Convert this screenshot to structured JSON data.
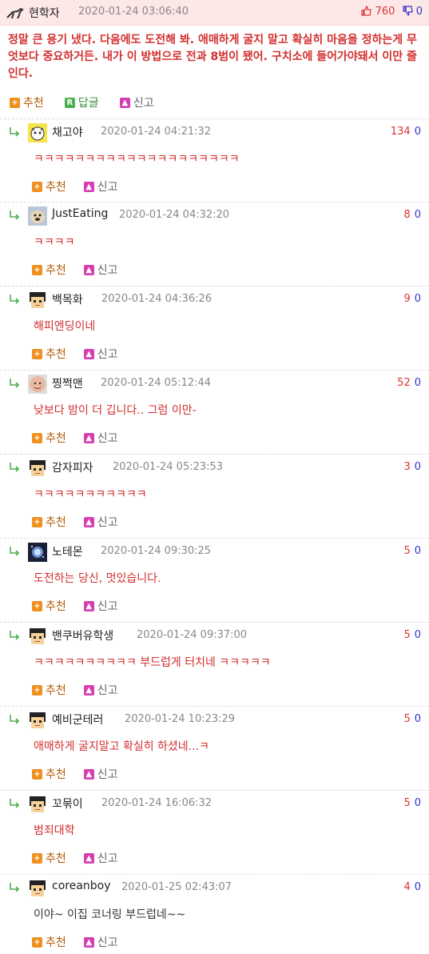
{
  "main": {
    "nick": "현학자",
    "date": "2020-01-24 03:06:40",
    "up": "760",
    "down": "0",
    "body": "정말 큰 용기 냈다. 다음에도 도전해 봐. 애매하게 굴지 말고 확실히 마음을 정하는게 무엇보다 중요하거든. 내가 이 방법으로 전과 8범이 됐어. 구치소에 들어가야돼서 이만 줄인다.",
    "actions": {
      "recommend": "추천",
      "reply": "답글",
      "report": "신고"
    },
    "icons": {
      "avatar": "walking-animal-icon",
      "up": "thumbs-up-icon",
      "down": "thumbs-down-icon"
    }
  },
  "comment_actions": {
    "recommend": "추천",
    "report": "신고"
  },
  "colors": {
    "header_bg": "#fde8e8",
    "comment_text": "#d32f2f",
    "up": "#dd3333",
    "down": "#3333cc",
    "action": "#b55a00"
  },
  "comments": [
    {
      "nick": "채고야",
      "date": "2020-01-24 04:21:32",
      "up": "134",
      "down": "0",
      "body": "ㅋㅋㅋㅋㅋㅋㅋㅋㅋㅋㅋㅋㅋㅋㅋㅋㅋㅋㅋㅋ",
      "avatar": "cat-avatar"
    },
    {
      "nick": "JustEating",
      "date": "2020-01-24 04:32:20",
      "up": "8",
      "down": "0",
      "body": "ㅋㅋㅋㅋ",
      "avatar": "dog-avatar"
    },
    {
      "nick": "백목화",
      "date": "2020-01-24 04:36:26",
      "up": "9",
      "down": "0",
      "body": "해피엔딩이네",
      "avatar": "pixel-person-avatar"
    },
    {
      "nick": "찡쩍맨",
      "date": "2020-01-24 05:12:44",
      "up": "52",
      "down": "0",
      "body": "낮보다 밤이 더 깁니다.. 그럼 이만-",
      "avatar": "face-avatar"
    },
    {
      "nick": "감자피자",
      "date": "2020-01-24 05:23:53",
      "up": "3",
      "down": "0",
      "body": "ㅋㅋㅋㅋㅋㅋㅋㅋㅋㅋㅋ",
      "avatar": "pixel-person-avatar"
    },
    {
      "nick": "노테몬",
      "date": "2020-01-24 09:30:25",
      "up": "5",
      "down": "0",
      "body": "도전하는 당신, 멋있습니다.",
      "avatar": "galaxy-avatar"
    },
    {
      "nick": "밴쿠버유학생",
      "date": "2020-01-24 09:37:00",
      "up": "5",
      "down": "0",
      "body": "ㅋㅋㅋㅋㅋㅋㅋㅋㅋㅋ 부드럽게 터치네 ㅋㅋㅋㅋㅋ",
      "avatar": "pixel-person-avatar"
    },
    {
      "nick": "예비군테러",
      "date": "2020-01-24 10:23:29",
      "up": "5",
      "down": "0",
      "body": "애매하게 굴지말고 확실히 하셨네...ㅋ",
      "avatar": "pixel-person-avatar"
    },
    {
      "nick": "꼬묶이",
      "date": "2020-01-24 16:06:32",
      "up": "5",
      "down": "0",
      "body": "범죄대학",
      "avatar": "pixel-person-avatar"
    },
    {
      "nick": "coreanboy",
      "date": "2020-01-25 02:43:07",
      "up": "4",
      "down": "0",
      "body": "이야~ 이집 코너링 부드럽네~~",
      "avatar": "pixel-person-avatar",
      "dark": true
    }
  ]
}
